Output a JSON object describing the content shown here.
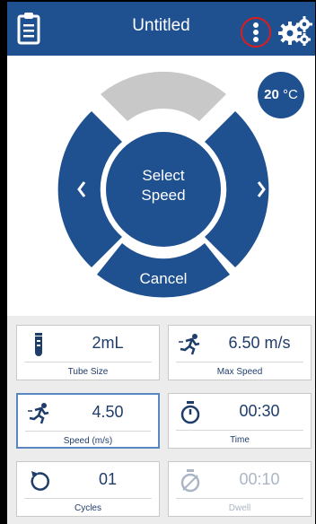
{
  "header": {
    "title": "Untitled",
    "icons": [
      "clipboard-icon",
      "kebab-menu-icon",
      "gears-icon"
    ],
    "bar_color": "#1f5090",
    "highlight_color": "#e01b1b"
  },
  "temperature": {
    "value": "20",
    "unit": "°C"
  },
  "dial": {
    "center_line1": "Select",
    "center_line2": "Speed",
    "cancel_label": "Cancel",
    "left_icon": "chevron-left-icon",
    "right_icon": "chevron-right-icon",
    "top_segment_state": "disabled"
  },
  "params": {
    "tube_size": {
      "value": "2mL",
      "caption": "Tube Size",
      "icon": "tube-icon"
    },
    "max_speed": {
      "value": "6.50 m/s",
      "caption": "Max Speed",
      "icon": "runner-icon"
    },
    "speed": {
      "value": "4.50",
      "caption": "Speed (m/s)",
      "icon": "runner-icon"
    },
    "time": {
      "value": "00:30",
      "caption": "Time",
      "icon": "stopwatch-icon"
    },
    "cycles": {
      "value": "01",
      "caption": "Cycles",
      "icon": "cycle-icon"
    },
    "dwell": {
      "value": "00:10",
      "caption": "Dwell",
      "icon": "dwell-timer-icon"
    }
  }
}
